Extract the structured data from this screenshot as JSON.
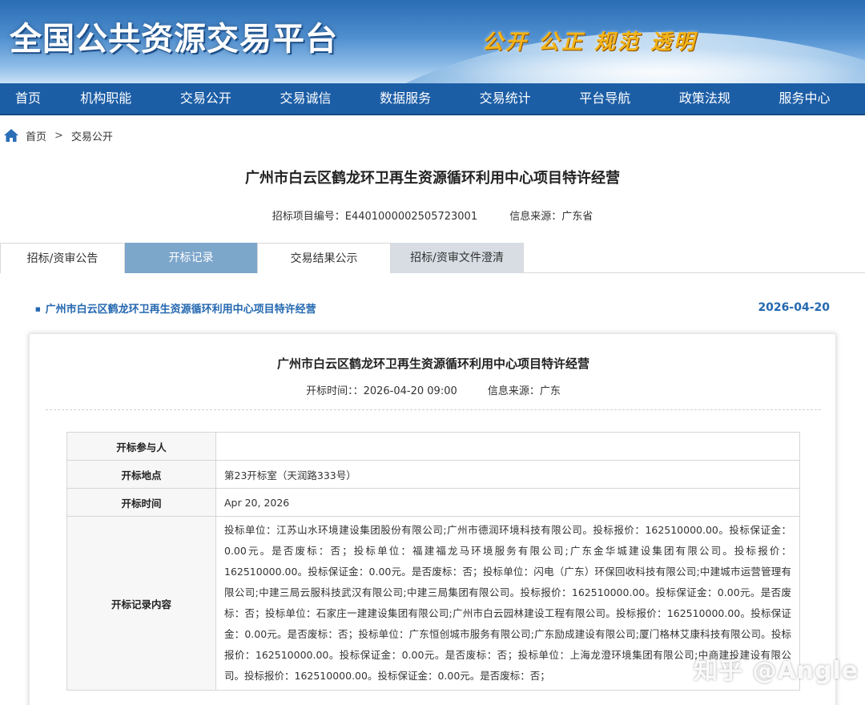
{
  "banner": {
    "title": "全国公共资源交易平台",
    "slogan": "公开 公正 规范 透明"
  },
  "nav": {
    "items": [
      "首页",
      "机构职能",
      "交易公开",
      "交易诚信",
      "数据服务",
      "交易统计",
      "平台导航",
      "政策法规",
      "服务中心"
    ]
  },
  "breadcrumb": {
    "home": "首页",
    "separator": ">",
    "current": "交易公开"
  },
  "page": {
    "title": "广州市白云区鹤龙环卫再生资源循环利用中心项目特许经营",
    "project_no": "招标项目编号：E4401000002505723001",
    "source": "信息来源：广东省"
  },
  "tabs": [
    "招标/资审公告",
    "开标记录",
    "交易结果公示",
    "招标/资审文件澄清"
  ],
  "active_tab": "开标记录",
  "section": {
    "link": "广州市白云区鹤龙环卫再生资源循环利用中心项目特许经营",
    "date": "2026-04-20"
  },
  "card": {
    "title": "广州市白云区鹤龙环卫再生资源循环利用中心项目特许经营",
    "open_time": "开标时间：：2026-04-20 09:00",
    "source": "信息来源：广东"
  },
  "table": {
    "rows": [
      {
        "label": "开标参与人",
        "value": ""
      },
      {
        "label": "开标地点",
        "value": "第23开标室（天润路333号）"
      },
      {
        "label": "开标时间",
        "value": "Apr 20, 2026"
      },
      {
        "label": "开标记录内容",
        "value": "投标单位：江苏山水环境建设集团股份有限公司;广州市德润环境科技有限公司。投标报价：162510000.00。投标保证金：0.00元。是否废标：否；投标单位：福建福龙马环境服务有限公司;广东金华城建设集团有限公司。投标报价：162510000.00。投标保证金：0.00元。是否废标：否；投标单位：闪电（广东）环保回收科技有限公司;中建城市运营管理有限公司;中建三局云服科技武汉有限公司;中建三局集团有限公司。投标报价：162510000.00。投标保证金：0.00元。是否废标：否；投标单位：石家庄一建建设集团有限公司;广州市白云园林建设工程有限公司。投标报价：162510000.00。投标保证金：0.00元。是否废标：否；投标单位：广东恒创城市服务有限公司;广东励成建设有限公司;厦门格林艾康科技有限公司。投标报价：162510000.00。投标保证金：0.00元。是否废标：否；投标单位：上海龙澄环境集团有限公司;中商建投建设有限公司。投标报价：162510000.00。投标保证金：0.00元。是否废标：否；"
      }
    ]
  },
  "watermark": "知乎 @Angle",
  "colors": {
    "nav_bg": "#1c5ea6",
    "active_tab_bg": "#7da6cb",
    "link": "#2468b0",
    "slogan": "#f2b418"
  }
}
